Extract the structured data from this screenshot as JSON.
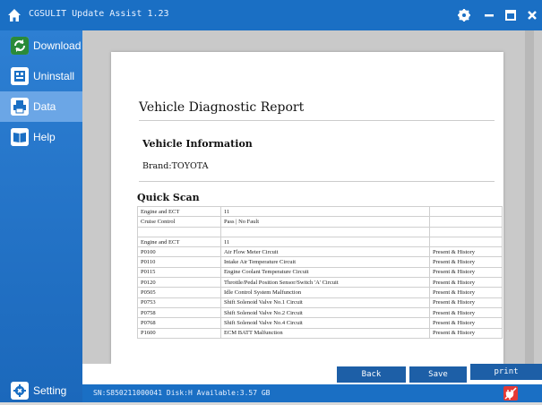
{
  "app": {
    "title": "CGSULIT Update Assist 1.23"
  },
  "sidebar": {
    "items": [
      {
        "label": "Download",
        "icon": "refresh-icon"
      },
      {
        "label": "Uninstall",
        "icon": "uninstall-icon"
      },
      {
        "label": "Data",
        "icon": "printer-icon",
        "active": true
      },
      {
        "label": "Help",
        "icon": "book-icon"
      }
    ],
    "setting_label": "Setting"
  },
  "report": {
    "title": "Vehicle Diagnostic Report",
    "vehicle_info_heading": "Vehicle Information",
    "brand": "Brand:TOYOTA",
    "quick_scan_heading": "Quick Scan",
    "rows": [
      [
        "Engine and ECT",
        "11",
        ""
      ],
      [
        "Cruise Control",
        "Pass | No Fault",
        ""
      ],
      [
        "",
        "",
        ""
      ],
      [
        "Engine and ECT",
        "11",
        ""
      ],
      [
        "P0100",
        "Air Flow Meter Circuit",
        "Present & History"
      ],
      [
        "P0110",
        "Intake Air Temperature Circuit",
        "Present & History"
      ],
      [
        "P0115",
        "Engine Coolant Temperature Circuit",
        "Present & History"
      ],
      [
        "P0120",
        "Throttle/Pedal Position Sensor/Switch 'A' Circuit",
        "Present & History"
      ],
      [
        "P0505",
        "Idle Control System Malfunction",
        "Present & History"
      ],
      [
        "P0753",
        "Shift Solenoid Valve No.1 Circuit",
        "Present & History"
      ],
      [
        "P0758",
        "Shift Solenoid Valve No.2 Circuit",
        "Present & History"
      ],
      [
        "P0768",
        "Shift Solenoid Valve No.4 Circuit",
        "Present & History"
      ],
      [
        "P1600",
        "ECM BATT Malfunction",
        "Present & History"
      ]
    ]
  },
  "buttons": {
    "back": "Back",
    "save": "Save",
    "print": "print"
  },
  "status": {
    "text": "SN:S850211000041  Disk:H  Available:3.57 GB"
  },
  "colors": {
    "titlebar": "#1a6fc4",
    "sidebar": "#2d7fd3",
    "button": "#1d5fa7",
    "active_nav": "#6ba6e6"
  }
}
